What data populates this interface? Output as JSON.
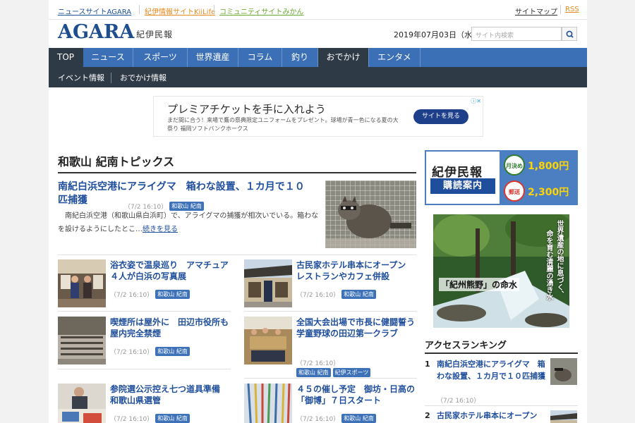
{
  "toplinks": {
    "agara": "ニュースサイトAGARA",
    "kiilife": "紀伊情報サイトKiiLife",
    "mikan": "コミュニティサイトみかん",
    "sitemap": "サイトマップ",
    "rss": "RSS"
  },
  "header": {
    "logo": "AGARA",
    "logo_sub": "紀伊民報",
    "date": "2019年07月03日（水）",
    "search_placeholder": "サイト内検索"
  },
  "nav": {
    "items": [
      "TOP",
      "ニュース",
      "スポーツ",
      "世界遺産",
      "コラム",
      "釣り",
      "おでかけ",
      "エンタメ"
    ],
    "active": "TOP",
    "subitems": [
      "イベント情報",
      "おでかけ情報"
    ]
  },
  "ad": {
    "title": "プレミアチケットを手に入れよう",
    "desc": "まだ間に合う！来場で鷹の祭典限定ユニフォームをプレゼント。球場が青一色になる夏の大祭り 福岡ソフトバンクホークス",
    "button": "サイトを見る"
  },
  "section": {
    "title": "和歌山 紀南トピックス"
  },
  "lead": {
    "title": "南紀白浜空港にアライグマ　箱わな設置、１カ月で１０匹捕獲",
    "date": "（7/2 16:10）",
    "tag": "和歌山 紀南",
    "body": "南紀白浜空港（和歌山県白浜町）で、アライグマの捕獲が相次いでいる。箱わなを設けるようにしたとこ…",
    "more": "続きを見る"
  },
  "articles": [
    {
      "title": "浴衣姿で温泉巡り　アマチュア４人が白浜の写真展",
      "date": "（7/2 16:10）",
      "tags": [
        "和歌山 紀南"
      ]
    },
    {
      "title": "古民家ホテル串本にオープン　レストランやカフェ併設",
      "date": "（7/2 16:10）",
      "tags": [
        "和歌山 紀南"
      ]
    },
    {
      "title": "喫煙所は屋外に　田辺市役所も屋内完全禁煙",
      "date": "（7/2 16:10）",
      "tags": [
        "和歌山 紀南"
      ]
    },
    {
      "title": "全国大会出場で市長に健闘誓う　学童野球の田辺第一クラブ",
      "date": "（7/2 16:10）",
      "tags": [
        "和歌山 紀南",
        "紀伊スポーツ"
      ]
    },
    {
      "title": "参院選公示控え七つ道具準備　和歌山県選管",
      "date": "（7/2 16:10）",
      "tags": [
        "和歌山 紀南"
      ]
    },
    {
      "title": "４５の催し予定　御坊・日高の「御博」７日スタート",
      "date": "（7/2 16:10）",
      "tags": [
        "和歌山 紀南"
      ]
    }
  ],
  "sidebar": {
    "sub_name": "紀伊民報",
    "sub_button": "購読案内",
    "monthly_label": "月決め",
    "monthly_price": "1,800円",
    "mail_label": "郵送",
    "mail_price": "2,300円",
    "banner_line1": "世界遺産の地に息づく、",
    "banner_line2": "命を育む清麗の湧き水",
    "banner_name": "「紀州熊野」の命水",
    "ranking_title": "アクセスランキング",
    "ranking": [
      {
        "num": "1",
        "title": "南紀白浜空港にアライグマ　箱わな設置、１カ月で１０匹捕獲",
        "date": "（7/2 16:10）"
      },
      {
        "num": "2",
        "title": "古民家ホテル串本にオープン"
      }
    ]
  },
  "colors": {
    "nav": "#3b6fb6",
    "nav_dark": "#2f3a47",
    "link": "#1f4e9c",
    "price": "#ffd400"
  }
}
